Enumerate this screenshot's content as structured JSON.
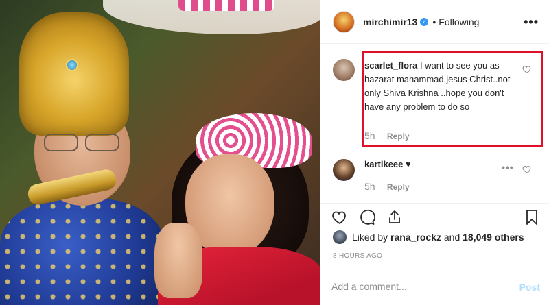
{
  "header": {
    "username": "mirchimir13",
    "separator": "•",
    "follow_status": "Following",
    "more_label": "•••"
  },
  "comments": [
    {
      "username": "scarlet_flora",
      "text": "I want to see you as hazarat mahammad.jesus Christ..not only Shiva Krishna ..hope you don't have any problem to do so",
      "time": "5h",
      "reply_label": "Reply"
    },
    {
      "username": "kartikeee",
      "text": "♥",
      "time": "5h",
      "reply_label": "Reply",
      "more_label": "•••"
    }
  ],
  "likes": {
    "prefix": "Liked by",
    "user": "rana_rockz",
    "joiner": "and",
    "count": "18,049 others"
  },
  "timeago": "8 HOURS AGO",
  "add_comment": {
    "placeholder": "Add a comment...",
    "post_label": "Post"
  },
  "icons": [
    "heart-icon",
    "comment-icon",
    "share-icon",
    "bookmark-icon",
    "verified-badge-icon",
    "more-icon"
  ],
  "colors": {
    "highlight": "#e0102a",
    "verified": "#3897f0",
    "post_disabled": "#b2dffc",
    "muted": "#8e8e8e"
  }
}
